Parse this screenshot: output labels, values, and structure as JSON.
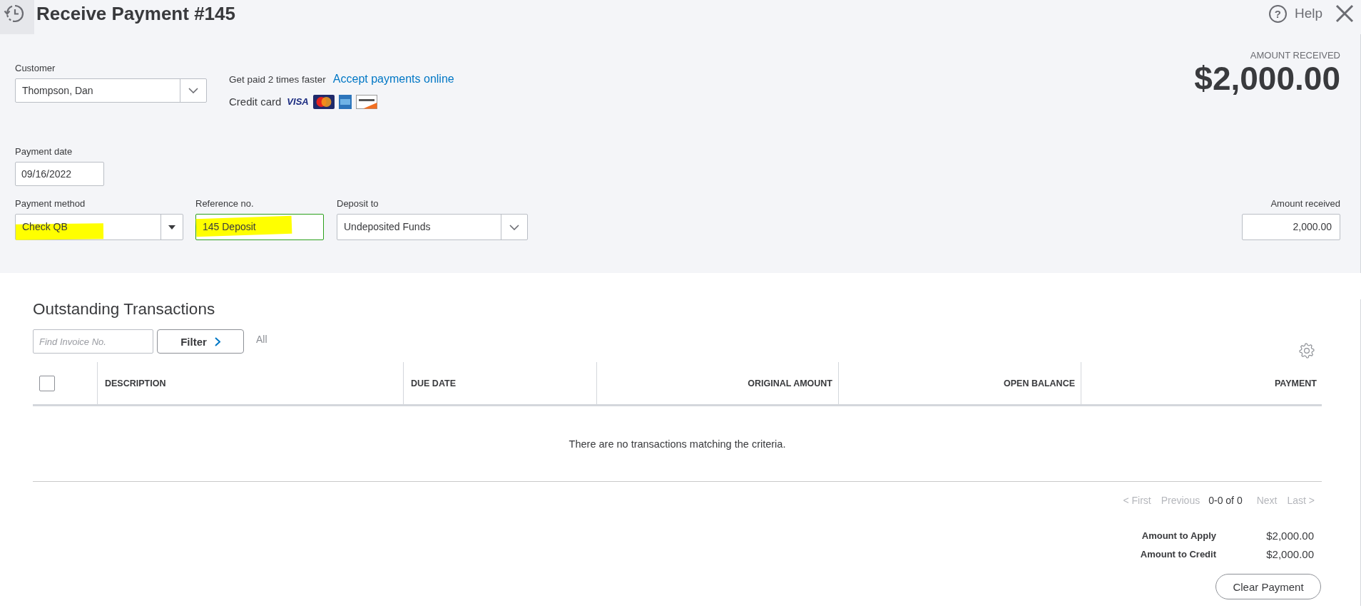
{
  "header": {
    "title": "Receive Payment #145",
    "help_icon": "?",
    "help": "Help"
  },
  "summary": {
    "label": "AMOUNT RECEIVED",
    "amount": "$2,000.00"
  },
  "customer": {
    "label": "Customer",
    "value": "Thompson, Dan"
  },
  "promo": {
    "text": "Get paid 2 times faster",
    "link": "Accept payments online",
    "cards_label": "Credit card",
    "cards": [
      {
        "kind": "wordmark",
        "text": "VISA"
      },
      {
        "kind": "circles"
      },
      {
        "kind": "blue-tile"
      },
      {
        "kind": "stripe-tile"
      }
    ]
  },
  "payment_date": {
    "label": "Payment date",
    "value": "09/16/2022"
  },
  "payment_fields": [
    {
      "kind": "dropdown",
      "label": "Payment method",
      "value": "Check QB",
      "focused": false,
      "highlighted": true
    },
    {
      "kind": "text",
      "label": "Reference no.",
      "value": "145 Deposit",
      "focused": true,
      "highlighted": true
    },
    {
      "kind": "select",
      "label": "Deposit to",
      "value": "Undeposited Funds",
      "focused": false,
      "highlighted": false
    }
  ],
  "amount_received": {
    "label": "Amount received",
    "value": "2,000.00"
  },
  "transactions": {
    "title": "Outstanding Transactions",
    "search": {
      "placeholder": "Find Invoice No."
    },
    "filter_button": "Filter",
    "filter_value": "All",
    "select_all": {
      "checked": false
    },
    "columns": [
      {
        "label": "DESCRIPTION"
      },
      {
        "label": "DUE DATE"
      },
      {
        "label": "ORIGINAL AMOUNT"
      },
      {
        "label": "OPEN BALANCE"
      },
      {
        "label": "PAYMENT"
      }
    ],
    "empty_message": "There are no transactions matching the criteria."
  },
  "pagination": [
    {
      "kind": "link",
      "label": "< First",
      "disabled": true
    },
    {
      "kind": "link",
      "label": "Previous",
      "disabled": true
    },
    {
      "kind": "range",
      "label": "0-0 of 0",
      "disabled": false
    },
    {
      "kind": "link",
      "label": "Next",
      "disabled": true
    },
    {
      "kind": "link",
      "label": "Last >",
      "disabled": true
    }
  ],
  "totals": [
    {
      "label": "Amount to Apply",
      "value": "$2,000.00"
    },
    {
      "label": "Amount to Credit",
      "value": "$2,000.00"
    }
  ],
  "clear_button": "Clear Payment"
}
